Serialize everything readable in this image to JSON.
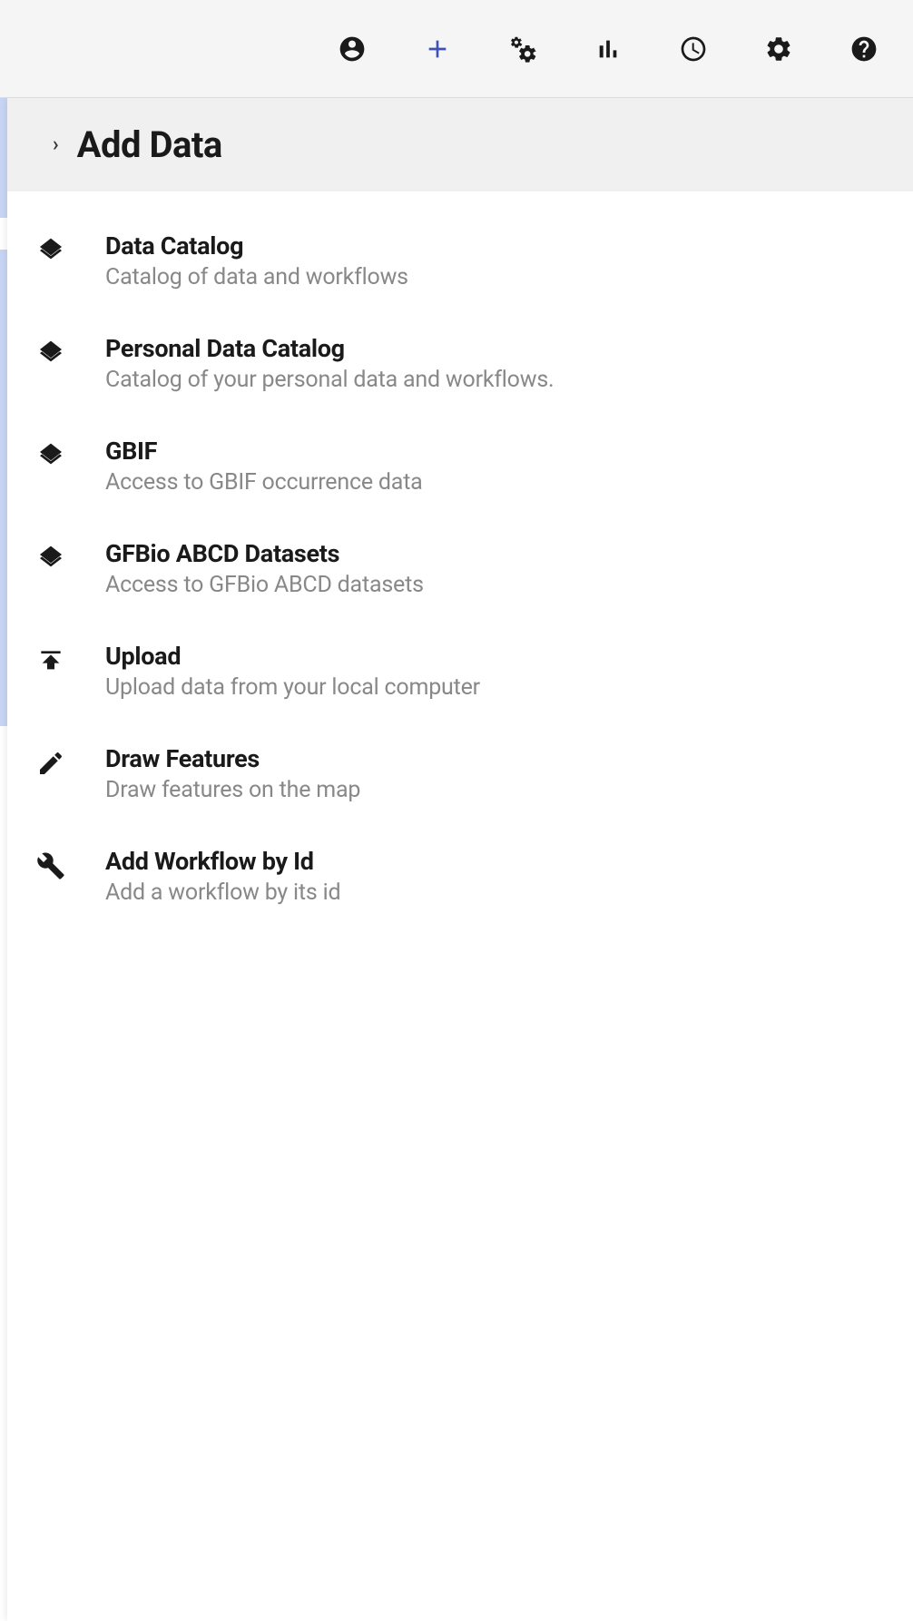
{
  "header": {
    "title": "Add Data"
  },
  "topbar": {
    "icons": [
      {
        "name": "account-icon"
      },
      {
        "name": "add-icon",
        "active": true
      },
      {
        "name": "gears-icon"
      },
      {
        "name": "chart-icon"
      },
      {
        "name": "clock-icon"
      },
      {
        "name": "settings-icon"
      },
      {
        "name": "help-icon"
      }
    ]
  },
  "items": [
    {
      "icon": "layers-icon",
      "title": "Data Catalog",
      "desc": "Catalog of data and workflows"
    },
    {
      "icon": "layers-icon",
      "title": "Personal Data Catalog",
      "desc": "Catalog of your personal data and workflows."
    },
    {
      "icon": "layers-icon",
      "title": "GBIF",
      "desc": "Access to GBIF occurrence data"
    },
    {
      "icon": "layers-icon",
      "title": "GFBio ABCD Datasets",
      "desc": "Access to GFBio ABCD datasets"
    },
    {
      "icon": "upload-icon",
      "title": "Upload",
      "desc": "Upload data from your local computer"
    },
    {
      "icon": "pencil-icon",
      "title": "Draw Features",
      "desc": "Draw features on the map"
    },
    {
      "icon": "wrench-icon",
      "title": "Add Workflow by Id",
      "desc": "Add a workflow by its id"
    }
  ]
}
